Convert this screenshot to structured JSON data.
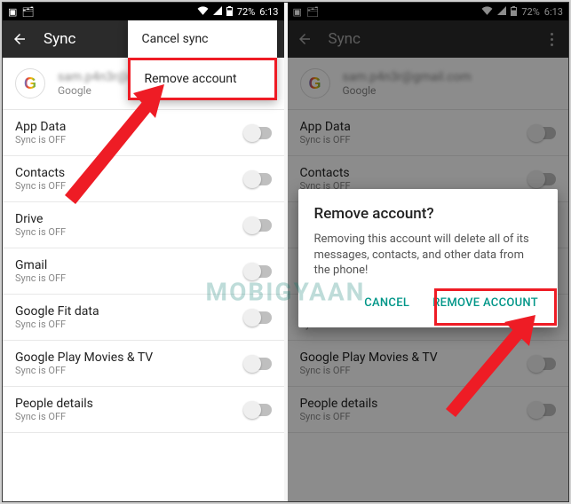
{
  "status": {
    "battery": "72%",
    "time": "6:13"
  },
  "appbar": {
    "title": "Sync"
  },
  "account": {
    "email": "sam.p4n3r@gmail.com",
    "provider": "Google"
  },
  "menu": {
    "cancel_sync": "Cancel sync",
    "remove_account": "Remove account"
  },
  "sync_sub": "Sync is OFF",
  "items": [
    {
      "title": "App Data"
    },
    {
      "title": "Contacts"
    },
    {
      "title": "Drive"
    },
    {
      "title": "Gmail"
    },
    {
      "title": "Google Fit data"
    },
    {
      "title": "Google Play Movies & TV"
    },
    {
      "title": "People details"
    }
  ],
  "dialog": {
    "title": "Remove account?",
    "body": "Removing this account will delete all of its messages, contacts, and other data from the phone!",
    "cancel": "CANCEL",
    "confirm": "REMOVE ACCOUNT"
  },
  "watermark": "MOBIGYAAN"
}
